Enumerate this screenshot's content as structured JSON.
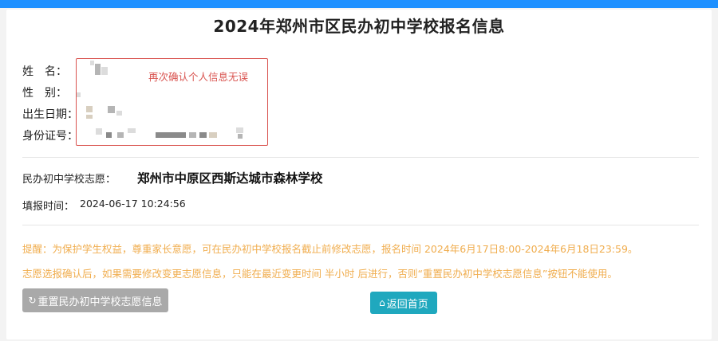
{
  "page": {
    "title": "2024年郑州市区民办初中学校报名信息"
  },
  "personal": {
    "name_label": "姓　名：",
    "gender_label": "性　别：",
    "birth_label": "出生日期：",
    "id_label": "身份证号：",
    "confirm_note": "再次确认个人信息无误"
  },
  "choice": {
    "label": "民办初中学校志愿：",
    "school": "郑州市中原区西斯达城市森林学校"
  },
  "fill_time": {
    "label": "填报时间：",
    "value": "2024-06-17 10:24:56"
  },
  "notice": {
    "line1": "提醒：为保护学生权益，尊重家长意愿，可在民办初中学校报名截止前修改志愿，报名时间 2024年6月17日8:00-2024年6月18日23:59。",
    "line2": "志愿选报确认后，如果需要修改变更志愿信息，只能在最近变更时间 半小时 后进行，否则“重置民办初中学校志愿信息”按钮不能使用。"
  },
  "buttons": {
    "reset_label": "重置民办初中学校志愿信息",
    "reset_icon": "refresh-icon",
    "home_label": "返回首页",
    "home_icon": "home-icon"
  },
  "colors": {
    "top_bar": "#1e90ff",
    "warning_red": "#d9534f",
    "notice_orange": "#f0ad4e",
    "reset_button": "#a9a9a9",
    "home_button": "#1fa8be"
  }
}
